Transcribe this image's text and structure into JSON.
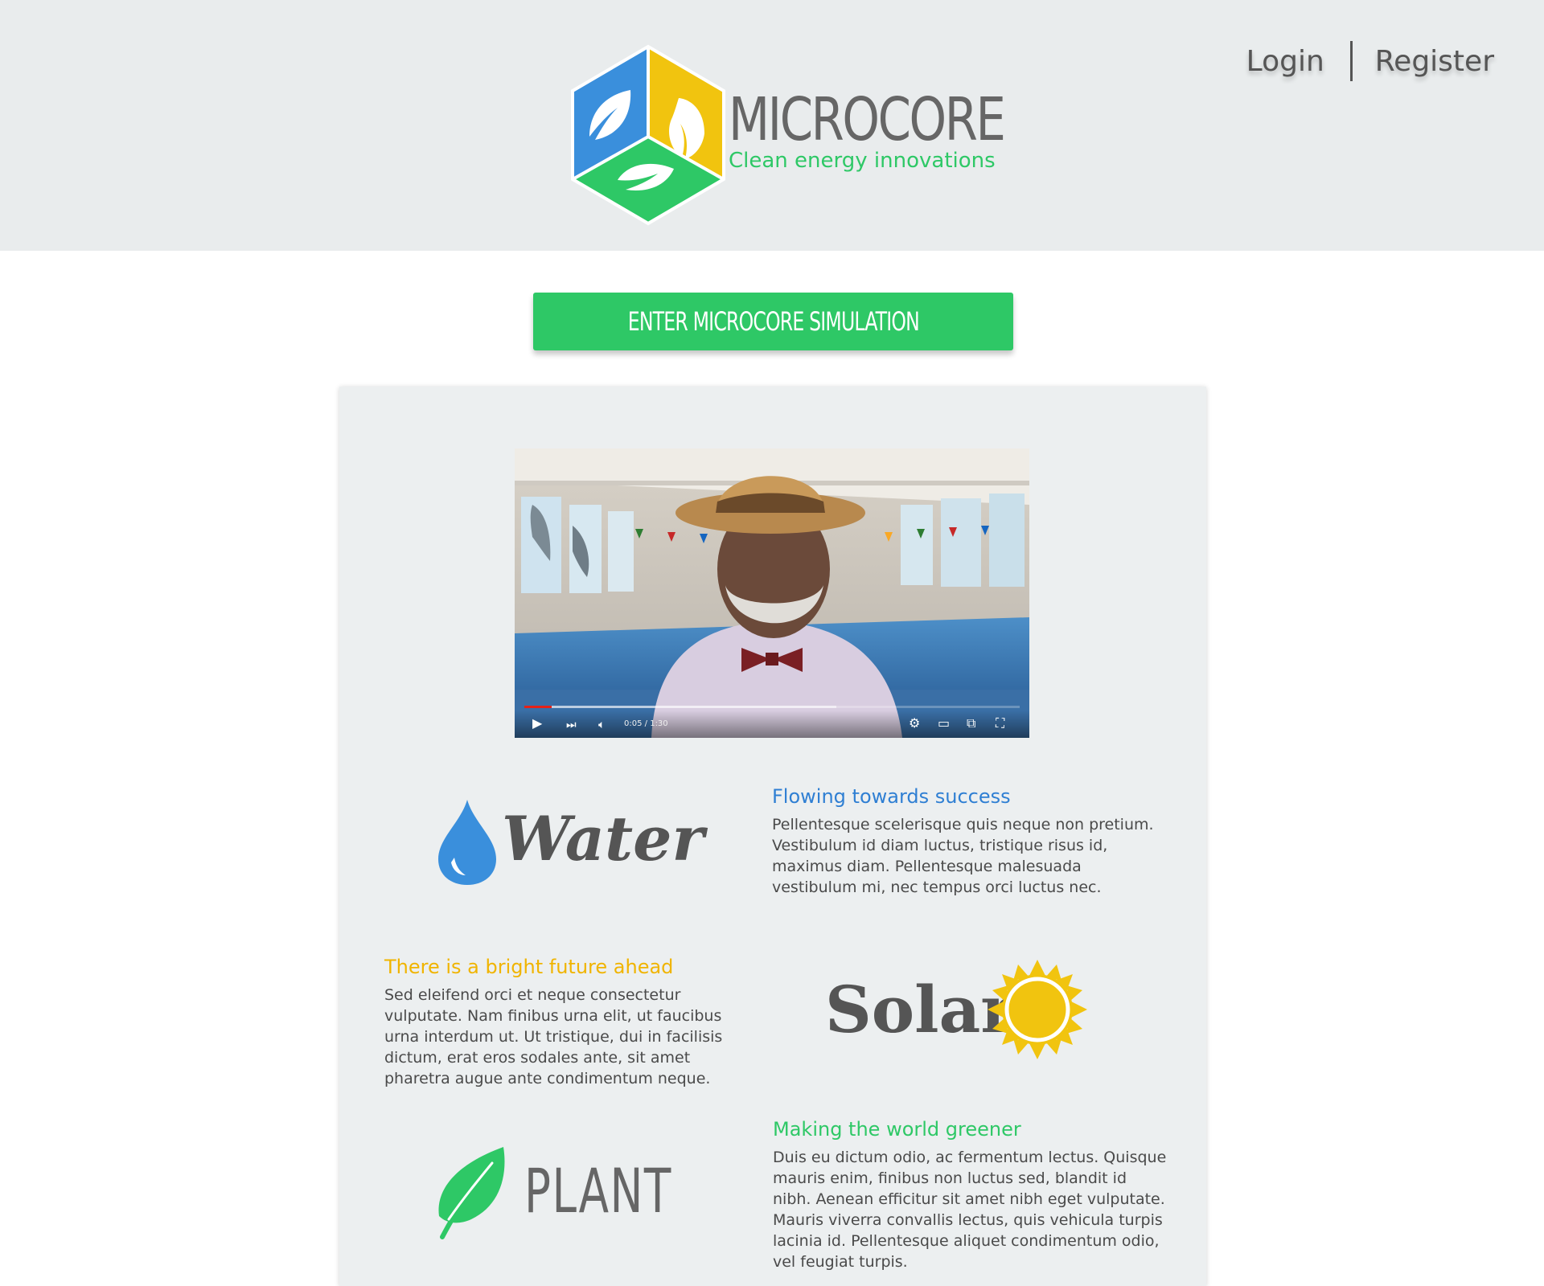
{
  "header": {
    "brand_name": "MICROCORE",
    "tagline": "Clean energy innovations",
    "login_label": "Login",
    "register_label": "Register"
  },
  "cta": {
    "label": "ENTER MICROCORE SIMULATION"
  },
  "video": {
    "current_time": "0:05",
    "duration": "1:30",
    "time_separator": " / ",
    "played_fraction": 0.055,
    "buffered_fraction": 0.63
  },
  "features": [
    {
      "emblem": "Water",
      "heading": "Flowing towards success",
      "body": "Pellentesque scelerisque quis neque non pretium. Vestibulum id diam luctus, tristique risus id, maximus diam. Pellentesque malesuada vestibulum mi, nec tempus orci luctus nec."
    },
    {
      "emblem": "Solar",
      "heading": "There is a bright future ahead",
      "body": "Sed eleifend orci et neque consectetur vulputate. Nam finibus urna elit, ut faucibus urna interdum ut. Ut tristique, dui in facilisis dictum, erat eros sodales ante, sit amet pharetra augue ante condimentum neque."
    },
    {
      "emblem": "PLANT",
      "heading": "Making the world greener",
      "body": "Duis eu dictum odio, ac fermentum lectus. Quisque mauris enim, finibus non luctus sed, blandit id nibh. Aenean efficitur sit amet nibh eget vulputate. Mauris viverra convallis lectus, quis vehicula turpis lacinia id. Pellentesque aliquet condimentum odio, vel feugiat turpis."
    }
  ],
  "colors": {
    "blue": "#3a8fdc",
    "yellow": "#f1c40f",
    "green": "#2ec866",
    "heading_blue": "#2f7fd3",
    "heading_yellow": "#f0b400",
    "text_gray": "#4a4a4a",
    "header_bg": "#e9eced",
    "panel_bg": "#eceff0"
  },
  "icons": [
    "microcore-logo-icon",
    "water-drop-icon",
    "sun-icon",
    "leaf-icon",
    "play-icon",
    "next-icon",
    "volume-icon",
    "settings-icon",
    "theater-mode-icon",
    "cast-icon",
    "fullscreen-icon"
  ]
}
